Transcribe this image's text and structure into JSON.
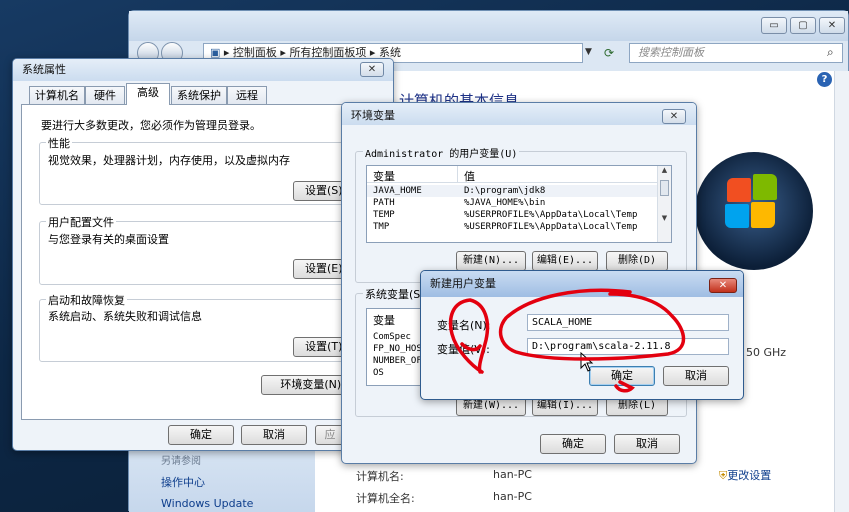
{
  "cp": {
    "address": [
      "控制面板",
      "所有控制面板项",
      "系统"
    ],
    "search_placeholder": "搜索控制面板",
    "heading": "计算机的基本信息",
    "cpu_freq": "50 GHz",
    "see_also": "另请参阅",
    "links": [
      "操作中心",
      "Windows Update"
    ],
    "computer_name_label": "计算机名:",
    "computer_name": "han-PC",
    "full_name_label": "计算机全名:",
    "full_name": "han-PC",
    "change_settings": "更改设置",
    "help": "?",
    "min": "▭",
    "max": "▢",
    "close": "✕"
  },
  "sysprop": {
    "title": "系统属性",
    "close": "✕",
    "tabs": [
      "计算机名",
      "硬件",
      "高级",
      "系统保护",
      "远程"
    ],
    "admin_note": "要进行大多数更改，您必须作为管理员登录。",
    "perf_title": "性能",
    "perf_desc": "视觉效果，处理器计划，内存使用，以及虚拟内存",
    "perf_btn": "设置(S)...",
    "profile_title": "用户配置文件",
    "profile_desc": "与您登录有关的桌面设置",
    "profile_btn": "设置(E)...",
    "startup_title": "启动和故障恢复",
    "startup_desc": "系统启动、系统失败和调试信息",
    "startup_btn": "设置(T)...",
    "env_btn": "环境变量(N)...",
    "ok": "确定",
    "cancel": "取消",
    "apply": "应"
  },
  "envvars": {
    "title": "环境变量",
    "close": "✕",
    "user_group": "Administrator 的用户变量(U)",
    "col_var": "变量",
    "col_val": "值",
    "user_vars": [
      {
        "name": "JAVA_HOME",
        "value": "D:\\program\\jdk8"
      },
      {
        "name": "PATH",
        "value": "%JAVA_HOME%\\bin"
      },
      {
        "name": "TEMP",
        "value": "%USERPROFILE%\\AppData\\Local\\Temp"
      },
      {
        "name": "TMP",
        "value": "%USERPROFILE%\\AppData\\Local\\Temp"
      }
    ],
    "new_btn": "新建(N)...",
    "edit_btn": "编辑(E)...",
    "delete_btn": "删除(D)",
    "sys_group": "系统变量(S",
    "sys_vars": [
      "ComSpec",
      "FP_NO_HOS",
      "NUMBER_OF",
      "OS"
    ],
    "sys_new": "新建(W)...",
    "sys_edit": "编辑(I)...",
    "sys_delete": "删除(L)",
    "ok": "确定",
    "cancel": "取消"
  },
  "newvar": {
    "title": "新建用户变量",
    "close": "✕",
    "name_label": "变量名(N):",
    "name_value": "SCALA_HOME",
    "value_label": "变量值(V):",
    "value_value": "D:\\program\\scala-2.11.8",
    "ok": "确定",
    "cancel": "取消"
  }
}
